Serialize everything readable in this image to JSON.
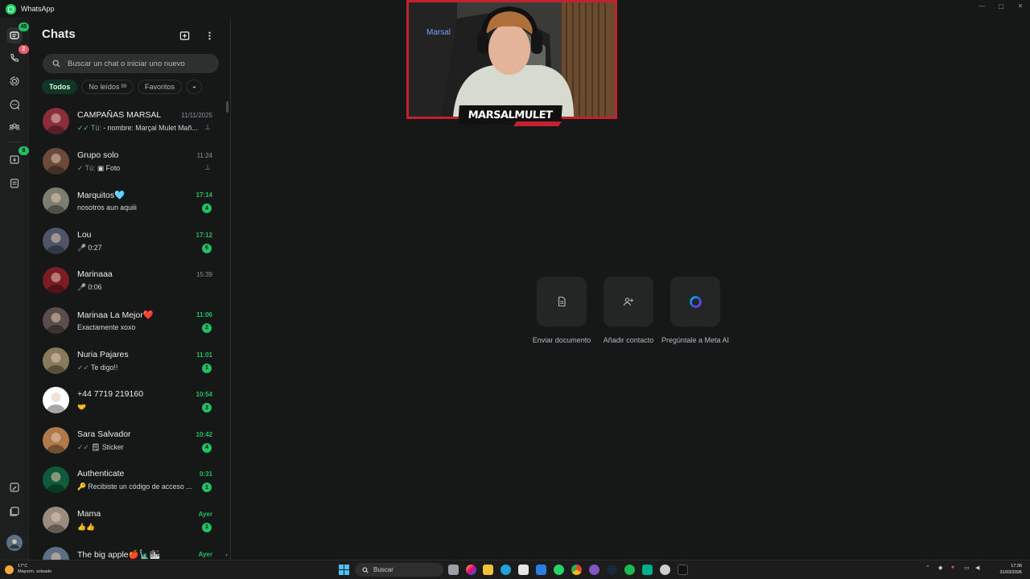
{
  "window": {
    "title": "WhatsApp"
  },
  "rail": {
    "chats_badge": "45",
    "calls_badge": "2",
    "archive_badge": "8"
  },
  "sidebar": {
    "title": "Chats",
    "search_placeholder": "Buscar un chat o iniciar uno nuevo",
    "filters": {
      "all": "Todos",
      "unread": "No leídos",
      "unread_count": "99",
      "favorites": "Favoritos"
    }
  },
  "chats": [
    {
      "name": "CAMPAÑAS MARSAL",
      "time": "11/11/2025",
      "time_green": false,
      "ticks": "✓✓",
      "sender": "Tú:",
      "message": "- nombre: Marçal Mulet Mañ...",
      "pinned": true,
      "unread": "",
      "avatar": "#8b2d3a"
    },
    {
      "name": "Grupo solo",
      "time": "11:24",
      "time_green": false,
      "ticks": "✓",
      "sender": "Tú:",
      "message": "▣ Foto",
      "pinned": true,
      "unread": "",
      "avatar": "#6b4a3a"
    },
    {
      "name": "Marquitos🩵",
      "time": "17:14",
      "time_green": true,
      "ticks": "",
      "sender": "",
      "message": "nosotros aun aquiii",
      "pinned": false,
      "unread": "4",
      "avatar": "#7d7d72"
    },
    {
      "name": "Lou",
      "time": "17:12",
      "time_green": true,
      "ticks": "",
      "sender": "",
      "message": "🎤 0:27",
      "pinned": false,
      "unread": "6",
      "avatar": "#4d5566"
    },
    {
      "name": "Marinaaa",
      "time": "15:39",
      "time_green": false,
      "ticks": "",
      "sender": "",
      "message": "🎤 0:06",
      "pinned": false,
      "unread": "",
      "avatar": "#7a1c22"
    },
    {
      "name": "Marinaa La Mejor❤️",
      "time": "11:06",
      "time_green": true,
      "ticks": "",
      "sender": "",
      "message": "Exactamente xoxo",
      "pinned": false,
      "unread": "2",
      "avatar": "#5a4e4a"
    },
    {
      "name": "Nuria Pajares",
      "time": "11:01",
      "time_green": true,
      "ticks": "✓✓",
      "sender": "",
      "message": "Te digo!!",
      "pinned": false,
      "unread": "1",
      "avatar": "#8a7a5c"
    },
    {
      "name": "+44 7719 219160",
      "time": "10:54",
      "time_green": true,
      "ticks": "",
      "sender": "",
      "message": "🤝",
      "pinned": false,
      "unread": "3",
      "avatar": "#ffffff"
    },
    {
      "name": "Sara Salvador",
      "time": "10:42",
      "time_green": true,
      "ticks": "✓✓",
      "sender": "",
      "message": "🗒 Sticker",
      "pinned": false,
      "unread": "4",
      "avatar": "#b07a4a"
    },
    {
      "name": "Authenticate",
      "time": "0:31",
      "time_green": true,
      "ticks": "",
      "sender": "",
      "message": "🔑 Recibiste un código de acceso ...",
      "pinned": false,
      "unread": "1",
      "avatar": "#0f5a3a"
    },
    {
      "name": "Mama",
      "time": "Ayer",
      "time_green": true,
      "ticks": "",
      "sender": "",
      "message": "👍👍",
      "pinned": false,
      "unread": "1",
      "avatar": "#9a8c7e"
    },
    {
      "name": "The big apple🍎🗽🏙",
      "time": "Ayer",
      "time_green": true,
      "ticks": "",
      "sender": "",
      "message": "",
      "pinned": false,
      "unread": "",
      "avatar": "#5d6f84"
    }
  ],
  "overlay": {
    "streamer_name": "MARSALMULET",
    "mic_label": "Marsal"
  },
  "actions": [
    {
      "label": "Enviar documento",
      "icon": "document-icon"
    },
    {
      "label": "Añadir contacto",
      "icon": "add-contact-icon"
    },
    {
      "label": "Pregúntale a Meta AI",
      "icon": "meta-ai-icon"
    }
  ],
  "taskbar": {
    "weather_temp": "17°C",
    "weather_desc": "Mayorm. soleado",
    "search_label": "Buscar",
    "time": "17:36",
    "date": "31/03/2026"
  }
}
